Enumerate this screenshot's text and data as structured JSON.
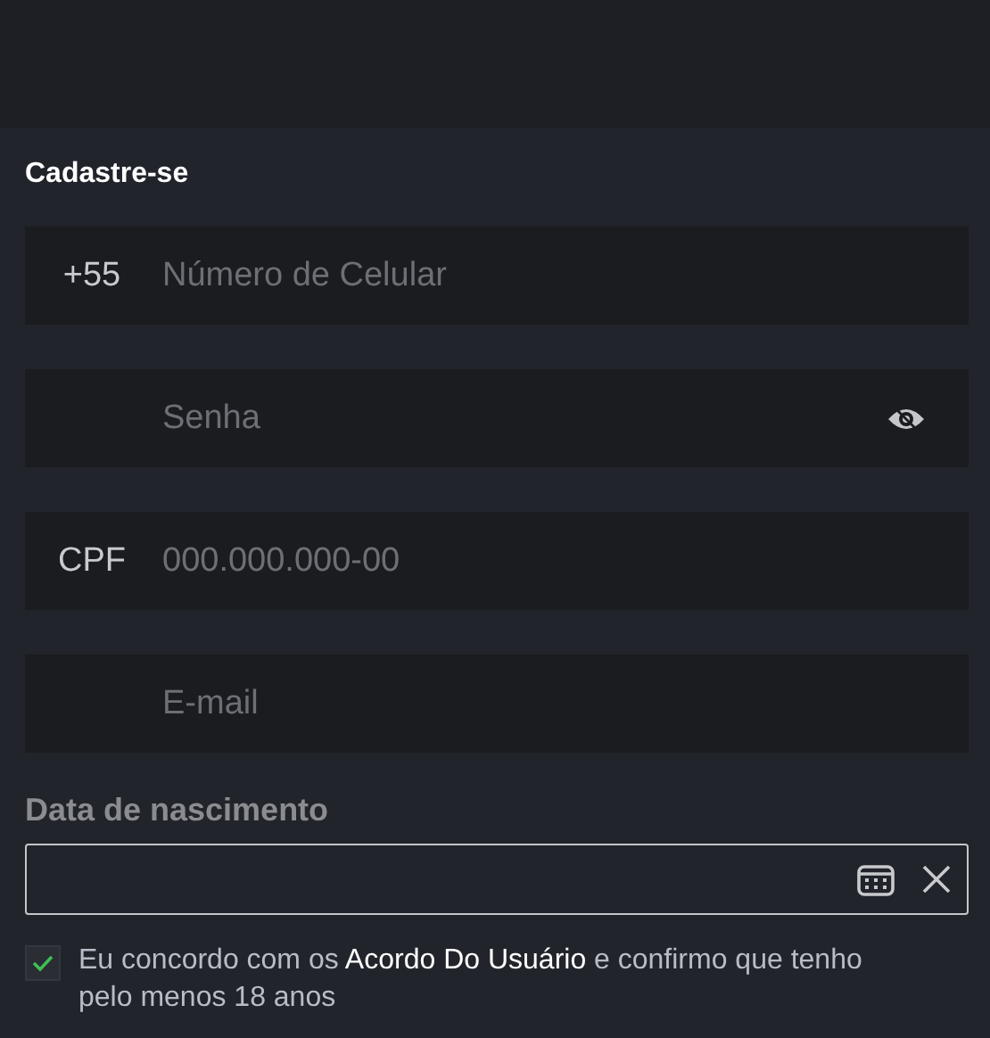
{
  "title": "Cadastre-se",
  "fields": [
    {
      "kind": "text",
      "prefix": "+55",
      "placeholder": "Número de Celular"
    },
    {
      "kind": "password",
      "placeholder": "Senha"
    },
    {
      "kind": "text",
      "prefix": "CPF",
      "placeholder": "000.000.000-00"
    },
    {
      "kind": "text",
      "placeholder": "E-mail"
    }
  ],
  "birth_date": {
    "label": "Data de nascimento"
  },
  "agreement": {
    "checked": true,
    "text_before": "Eu concordo com os ",
    "link": "Acordo Do Usuário",
    "text_after": " e confirmo que tenho pelo menos 18 anos"
  }
}
